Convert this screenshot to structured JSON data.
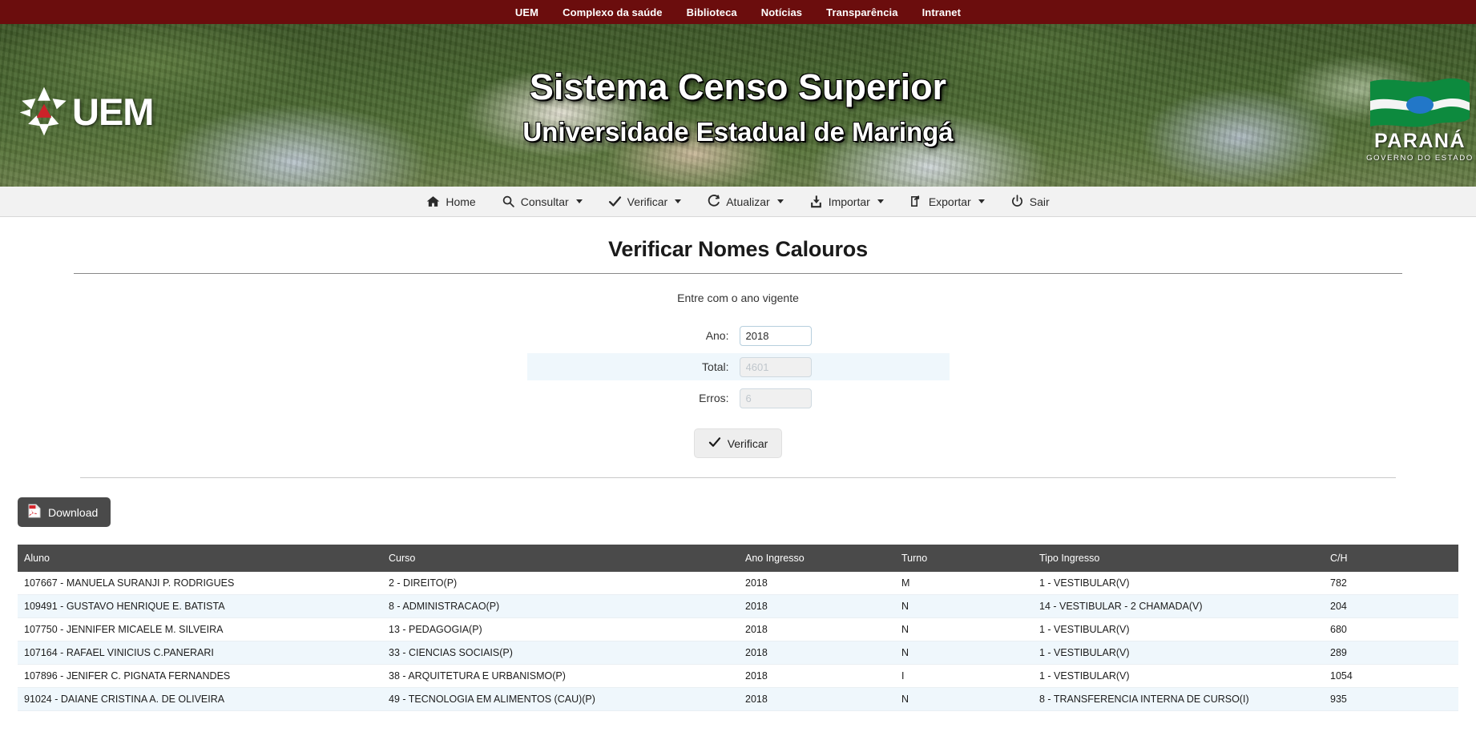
{
  "topnav": {
    "items": [
      {
        "label": "UEM",
        "name": "topnav-uem"
      },
      {
        "label": "Complexo da saúde",
        "name": "topnav-complexo-da-saude"
      },
      {
        "label": "Biblioteca",
        "name": "topnav-biblioteca"
      },
      {
        "label": "Notícias",
        "name": "topnav-noticias"
      },
      {
        "label": "Transparência",
        "name": "topnav-transparencia"
      },
      {
        "label": "Intranet",
        "name": "topnav-intranet"
      }
    ]
  },
  "banner": {
    "logo_text": "UEM",
    "title": "Sistema Censo Superior",
    "subtitle": "Universidade Estadual de Maringá",
    "parana_title": "PARANÁ",
    "parana_sub": "GOVERNO DO ESTADO"
  },
  "menubar": {
    "items": [
      {
        "label": "Home",
        "icon": "home-icon",
        "caret": false
      },
      {
        "label": "Consultar",
        "icon": "search-icon",
        "caret": true
      },
      {
        "label": "Verificar",
        "icon": "check-icon",
        "caret": true
      },
      {
        "label": "Atualizar",
        "icon": "refresh-icon",
        "caret": true
      },
      {
        "label": "Importar",
        "icon": "import-icon",
        "caret": true
      },
      {
        "label": "Exportar",
        "icon": "export-icon",
        "caret": true
      },
      {
        "label": "Sair",
        "icon": "power-icon",
        "caret": false
      }
    ]
  },
  "page": {
    "title": "Verificar Nomes Calouros",
    "subtitle": "Entre com o ano vigente"
  },
  "form": {
    "ano": {
      "label": "Ano:",
      "value": "2018",
      "placeholder": ""
    },
    "total": {
      "label": "Total:",
      "value": "",
      "placeholder": "4601"
    },
    "erros": {
      "label": "Erros:",
      "value": "",
      "placeholder": "6"
    },
    "verificar_label": "Verificar"
  },
  "actions": {
    "download_label": "Download",
    "download_icon": "pdf-icon"
  },
  "table": {
    "columns": [
      "Aluno",
      "Curso",
      "Ano Ingresso",
      "Turno",
      "Tipo Ingresso",
      "C/H"
    ],
    "rows": [
      {
        "aluno": "107667 - MANUELA SURANJI P. RODRIGUES",
        "curso": "2 - DIREITO(P)",
        "ano_ingresso": "2018",
        "turno": "M",
        "tipo_ingresso": "1 - VESTIBULAR(V)",
        "ch": "782"
      },
      {
        "aluno": "109491 - GUSTAVO HENRIQUE E. BATISTA",
        "curso": "8 - ADMINISTRACAO(P)",
        "ano_ingresso": "2018",
        "turno": "N",
        "tipo_ingresso": "14 - VESTIBULAR - 2 CHAMADA(V)",
        "ch": "204"
      },
      {
        "aluno": "107750 - JENNIFER MICAELE M. SILVEIRA",
        "curso": "13 - PEDAGOGIA(P)",
        "ano_ingresso": "2018",
        "turno": "N",
        "tipo_ingresso": "1 - VESTIBULAR(V)",
        "ch": "680"
      },
      {
        "aluno": "107164 - RAFAEL VINICIUS C.PANERARI",
        "curso": "33 - CIENCIAS SOCIAIS(P)",
        "ano_ingresso": "2018",
        "turno": "N",
        "tipo_ingresso": "1 - VESTIBULAR(V)",
        "ch": "289"
      },
      {
        "aluno": "107896 - JENIFER C. PIGNATA FERNANDES",
        "curso": "38 - ARQUITETURA E URBANISMO(P)",
        "ano_ingresso": "2018",
        "turno": "I",
        "tipo_ingresso": "1 - VESTIBULAR(V)",
        "ch": "1054"
      },
      {
        "aluno": "91024 - DAIANE CRISTINA A. DE OLIVEIRA",
        "curso": "49 - TECNOLOGIA EM ALIMENTOS (CAU)(P)",
        "ano_ingresso": "2018",
        "turno": "N",
        "tipo_ingresso": "8 - TRANSFERENCIA INTERNA DE CURSO(I)",
        "ch": "935"
      }
    ]
  },
  "colors": {
    "topbar": "#6b0d0d",
    "table_header": "#4a4a4a",
    "row_alt": "#eff7fc",
    "download_btn": "#4a4a4a",
    "uem_red": "#cc2229",
    "parana_green": "#0d8a3e",
    "parana_blue": "#2277c8"
  }
}
